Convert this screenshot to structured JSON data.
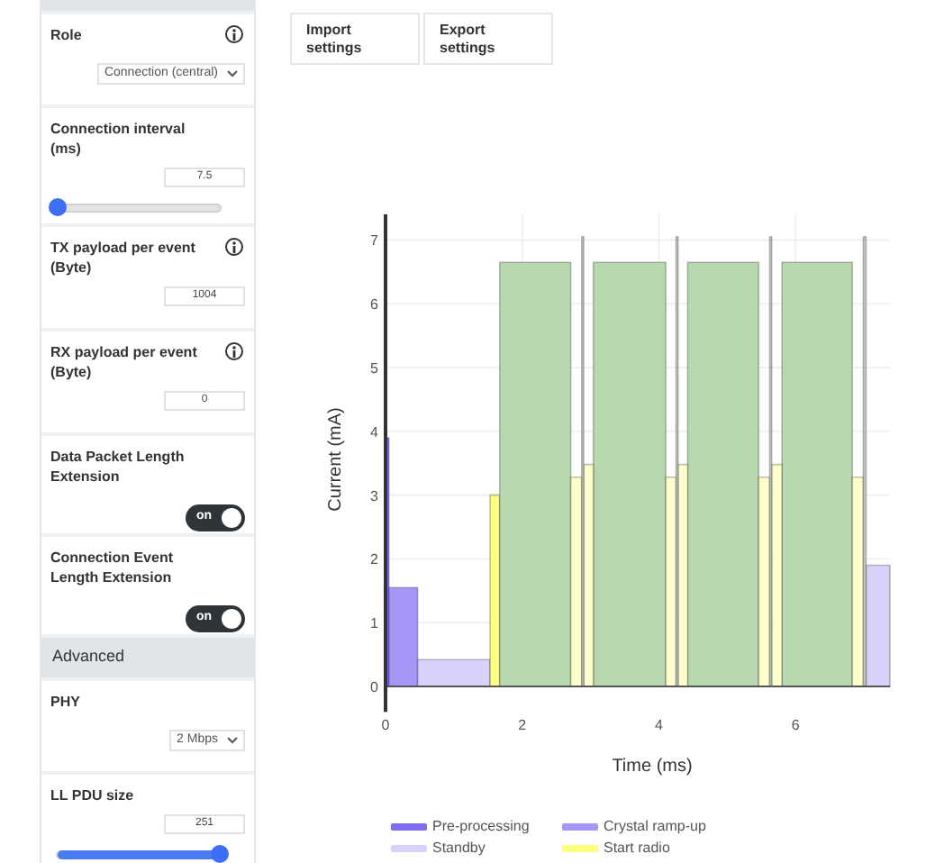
{
  "sidebar": {
    "items": [
      {
        "kind": "select",
        "label": "Role",
        "info": true,
        "value": "Connection (central)"
      },
      {
        "kind": "slider",
        "label": "Connection interval (ms)",
        "info": false,
        "value": "7.5",
        "level": 0
      },
      {
        "kind": "number",
        "label": "TX payload per event (Byte)",
        "info": true,
        "value": "1004"
      },
      {
        "kind": "number",
        "label": "RX payload per event (Byte)",
        "info": true,
        "value": "0"
      },
      {
        "kind": "toggle",
        "label": "Data Packet Length Extension",
        "info": false,
        "on": true,
        "text": "on"
      },
      {
        "kind": "toggle",
        "label": "Connection Event Length Extension",
        "info": false,
        "on": true,
        "text": "on"
      },
      {
        "kind": "header",
        "label": "Advanced"
      },
      {
        "kind": "select",
        "label": "PHY",
        "info": false,
        "value": "2 Mbps"
      },
      {
        "kind": "slider",
        "label": "LL PDU size",
        "info": false,
        "value": "251",
        "level": 1
      }
    ]
  },
  "buttons": [
    "Import settings",
    "Export settings"
  ],
  "chart": {
    "chart_data": {
      "type": "area",
      "xlabel": "Time (ms)",
      "ylabel": "Current (mA)",
      "grid": true,
      "x": [
        0,
        0.05,
        0.05,
        0.47,
        0.47,
        1.53,
        1.53,
        1.67,
        1.67,
        2.71,
        2.71,
        2.87,
        2.87,
        2.9,
        2.9,
        3.04,
        3.04,
        4.1,
        4.1,
        4.25,
        4.25,
        4.28,
        4.28,
        4.42,
        4.42,
        5.46,
        5.46,
        5.62,
        5.62,
        5.65,
        5.65,
        5.8,
        5.8,
        6.83,
        6.83,
        6.99,
        6.99,
        7.03,
        7.03,
        7.38
      ],
      "xlim": [
        0,
        7.38
      ],
      "ylim": [
        -0.4,
        7.4
      ],
      "xticks": [
        0,
        2,
        4,
        6
      ],
      "yticks": [
        0,
        1,
        2,
        3,
        4,
        5,
        6,
        7
      ],
      "series": [
        {
          "name": "Pre-processing",
          "color": "#7b6cf2",
          "values": [
            3.9,
            3.9,
            null,
            null,
            null,
            null,
            null,
            null,
            null,
            null,
            null,
            null,
            null,
            null,
            null,
            null,
            null,
            null,
            null,
            null,
            null,
            null,
            null,
            null,
            null,
            null,
            null,
            null,
            null,
            null,
            null,
            null,
            null,
            null,
            null,
            null,
            null,
            null,
            null,
            null
          ]
        },
        {
          "name": "Crystal ramp-up",
          "color": "#a597f7",
          "values": [
            null,
            null,
            1.55,
            1.55,
            null,
            null,
            null,
            null,
            null,
            null,
            null,
            null,
            null,
            null,
            null,
            null,
            null,
            null,
            null,
            null,
            null,
            null,
            null,
            null,
            null,
            null,
            null,
            null,
            null,
            null,
            null,
            null,
            null,
            null,
            null,
            null,
            null,
            null,
            null,
            null
          ]
        },
        {
          "name": "Standby",
          "color": "#d8d2fb",
          "values": [
            null,
            null,
            null,
            null,
            0.42,
            0.42,
            null,
            null,
            null,
            null,
            null,
            null,
            null,
            null,
            null,
            null,
            null,
            null,
            null,
            null,
            null,
            null,
            null,
            null,
            null,
            null,
            null,
            null,
            null,
            null,
            null,
            null,
            null,
            null,
            null,
            null,
            null,
            null,
            1.9,
            1.9
          ]
        },
        {
          "name": "Start radio",
          "color": "#ffff80",
          "values": [
            null,
            null,
            null,
            null,
            null,
            null,
            3.0,
            3.0,
            null,
            null,
            null,
            null,
            null,
            null,
            null,
            null,
            null,
            null,
            null,
            null,
            null,
            null,
            null,
            null,
            null,
            null,
            null,
            null,
            null,
            null,
            null,
            null,
            null,
            null,
            null,
            null,
            null,
            null,
            null,
            null
          ]
        },
        {
          "color": "#b8d8b0",
          "values": [
            null,
            null,
            null,
            null,
            null,
            null,
            null,
            null,
            6.65,
            6.65,
            null,
            null,
            null,
            null,
            null,
            null,
            6.65,
            6.65,
            null,
            null,
            null,
            null,
            null,
            null,
            6.65,
            6.65,
            null,
            null,
            null,
            null,
            null,
            null,
            6.65,
            6.65,
            null,
            null,
            null,
            null,
            null,
            null
          ]
        },
        {
          "color": "#ffffcc",
          "values": [
            null,
            null,
            null,
            null,
            null,
            null,
            null,
            null,
            null,
            null,
            3.28,
            3.28,
            null,
            null,
            3.48,
            3.48,
            null,
            null,
            3.28,
            3.28,
            null,
            null,
            3.48,
            3.48,
            null,
            null,
            3.28,
            3.28,
            null,
            null,
            3.48,
            3.48,
            null,
            null,
            3.28,
            3.28,
            null,
            null,
            null,
            null
          ]
        },
        {
          "color": "#c8cfc4",
          "values": [
            null,
            null,
            null,
            null,
            null,
            null,
            null,
            null,
            null,
            null,
            null,
            null,
            7.05,
            7.05,
            null,
            null,
            null,
            null,
            null,
            null,
            7.05,
            7.05,
            null,
            null,
            null,
            null,
            null,
            null,
            7.05,
            7.05,
            null,
            null,
            null,
            null,
            null,
            null,
            7.05,
            7.05,
            null,
            null
          ]
        }
      ]
    }
  }
}
